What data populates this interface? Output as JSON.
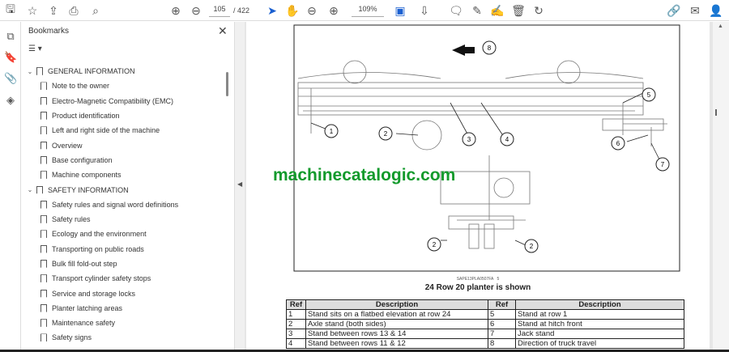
{
  "toolbar": {
    "page_current": "105",
    "page_total": "/ 422",
    "zoom": "109%"
  },
  "icons": [
    "save-icon",
    "star-icon",
    "upload-icon",
    "print-icon",
    "search-icon",
    "page-up-icon",
    "page-down-icon",
    "select-cursor-icon",
    "hand-icon",
    "zoom-out-icon",
    "zoom-in-icon",
    "fit-page-icon",
    "scroll-mode-icon",
    "comment-icon",
    "pen-icon",
    "sign-icon",
    "delete-icon",
    "rotate-icon",
    "share-icon",
    "mail-icon",
    "account-icon"
  ],
  "bookmarks": {
    "title": "Bookmarks",
    "items": [
      {
        "label": "GENERAL INFORMATION",
        "level": 0
      },
      {
        "label": "Note to the owner",
        "level": 1
      },
      {
        "label": "Electro-Magnetic Compatibility (EMC)",
        "level": 1
      },
      {
        "label": "Product identification",
        "level": 1
      },
      {
        "label": "Left and right side of the machine",
        "level": 1
      },
      {
        "label": "Overview",
        "level": 1
      },
      {
        "label": "Base configuration",
        "level": 1
      },
      {
        "label": "Machine components",
        "level": 1
      },
      {
        "label": "SAFETY INFORMATION",
        "level": 0
      },
      {
        "label": "Safety rules and signal word definitions",
        "level": 1
      },
      {
        "label": "Safety rules",
        "level": 1
      },
      {
        "label": "Ecology and the environment",
        "level": 1
      },
      {
        "label": "Transporting on public roads",
        "level": 1
      },
      {
        "label": "Bulk fill fold-out step",
        "level": 1
      },
      {
        "label": "Transport cylinder safety stops",
        "level": 1
      },
      {
        "label": "Service and storage locks",
        "level": 1
      },
      {
        "label": "Planter latching areas",
        "level": 1
      },
      {
        "label": "Maintenance safety",
        "level": 1
      },
      {
        "label": "Safety signs",
        "level": 1
      }
    ]
  },
  "document": {
    "watermark": "machinecatalogic.com",
    "watermark_color": "#139a2c",
    "figure_code": "SAPE13PLA0507FA",
    "figure_num": "5",
    "caption": "24 Row 20 planter is shown",
    "callouts": [
      "1",
      "2",
      "3",
      "4",
      "5",
      "6",
      "7",
      "8",
      "2",
      "2"
    ],
    "table": {
      "headers": [
        "Ref",
        "Description",
        "Ref",
        "Description"
      ],
      "rows": [
        [
          "1",
          "Stand sits on a flatbed elevation at row 24",
          "5",
          "Stand at row 1"
        ],
        [
          "2",
          "Axle stand (both sides)",
          "6",
          "Stand at hitch front"
        ],
        [
          "3",
          "Stand between rows 13 & 14",
          "7",
          "Jack stand"
        ],
        [
          "4",
          "Stand between rows 11 & 12",
          "8",
          "Direction of truck travel"
        ]
      ]
    }
  }
}
